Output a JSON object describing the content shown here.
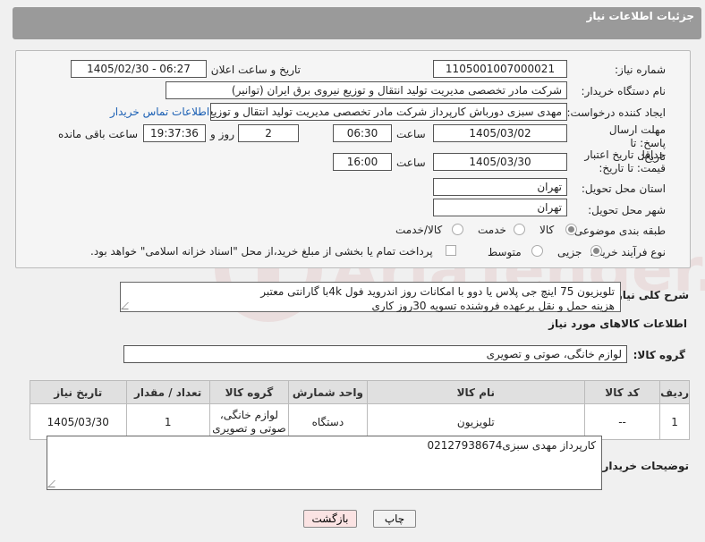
{
  "header": {
    "title": "جزئیات اطلاعات نیاز"
  },
  "fields": {
    "need_number_label": "شماره نیاز:",
    "need_number": "1105001007000021",
    "announce_label": "تاریخ و ساعت اعلان عمومی:",
    "announce_value": "1405/02/30 - 06:27",
    "buyer_org_label": "نام دستگاه خریدار:",
    "buyer_org": "شرکت مادر تخصصی مدیریت تولید  انتقال و توزیع نیروی برق ایران (توانیر)",
    "requester_label": "ایجاد کننده درخواست:",
    "requester": "مهدی سبزی دورباش کارپرداز شرکت مادر تخصصی مدیریت تولید  انتقال و توزیع ن",
    "contact_link": "اطلاعات تماس خریدار",
    "deadline_label": "مهلت ارسال پاسخ: تا تاریخ:",
    "deadline_date": "1405/03/02",
    "time_label": "ساعت",
    "deadline_time": "06:30",
    "days_value": "2",
    "days_label": "روز و",
    "remaining_time": "19:37:36",
    "remaining_label": "ساعت باقی مانده",
    "validity_label": "حداقل تاریخ اعتبار قیمت: تا تاریخ:",
    "validity_date": "1405/03/30",
    "validity_time_label": "ساعت",
    "validity_time": "16:00",
    "province_label": "استان محل تحویل:",
    "province": "تهران",
    "city_label": "شهر محل تحویل:",
    "city": "تهران",
    "category_label": "طبقه بندی موضوعی:",
    "category_options": [
      "کالا",
      "خدمت",
      "کالا/خدمت"
    ],
    "process_label": "نوع فرآیند خرید :",
    "process_options": [
      "جزیی",
      "متوسط"
    ],
    "payment_note": "پرداخت تمام یا بخشی از مبلغ خرید،از محل \"اسناد خزانه اسلامی\" خواهد بود."
  },
  "description": {
    "label": "شرح کلی نیاز:",
    "line1": "تلویزیون 75 اینچ جی پلاس یا دوو با امکانات روز اندروید فول 4kبا گارانتی معتبر",
    "line2": "هزینه حمل و نقل برعهده فروشنده تسویه 30روز کاری"
  },
  "goods_info_title": "اطلاعات کالاهای مورد نیاز",
  "goods_group": {
    "label": "گروه کالا:",
    "value": "لوازم خانگی، صوتی و تصویری"
  },
  "table": {
    "headers": [
      "ردیف",
      "کد کالا",
      "نام کالا",
      "واحد شمارش",
      "گروه کالا",
      "تعداد / مقدار",
      "تاریخ نیاز"
    ],
    "rows": [
      {
        "row": "1",
        "code": "--",
        "name": "تلویزیون",
        "unit": "دستگاه",
        "group": "لوازم خانگی، صوتی و تصویری",
        "qty": "1",
        "date": "1405/03/30"
      }
    ]
  },
  "buyer_notes": {
    "label": "توضیحات خریدار:",
    "value": "کارپرداز مهدی سبزی02127938674"
  },
  "buttons": {
    "print": "چاپ",
    "back": "بازگشت"
  },
  "watermark": "AriaTender.net"
}
